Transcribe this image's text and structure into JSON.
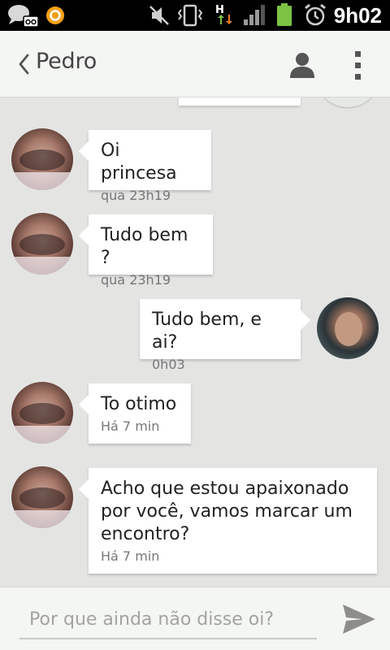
{
  "status_bar": {
    "time": "9h02",
    "icons": [
      "chat-notification-icon",
      "voicemail-icon",
      "app-notification-icon",
      "mute-icon",
      "vibrate-icon",
      "hspa-data-icon",
      "signal-icon",
      "battery-icon",
      "alarm-icon"
    ]
  },
  "header": {
    "contact_name": "Pedro",
    "icons": [
      "back-icon",
      "person-icon",
      "overflow-menu-icon"
    ]
  },
  "messages": [
    {
      "direction": "incoming",
      "text": "Oi princesa",
      "time": "qua  23h19"
    },
    {
      "direction": "incoming",
      "text": "Tudo bem ?",
      "time": "qua  23h19"
    },
    {
      "direction": "outgoing",
      "text": "Tudo bem, e ai?",
      "time": "0h03"
    },
    {
      "direction": "incoming",
      "text": "To otimo",
      "time": "Há 7 min"
    },
    {
      "direction": "incoming",
      "text": "Acho que estou apaixonado\npor você,  vamos marcar um\nencontro?",
      "time": "Há 7 min"
    }
  ],
  "compose": {
    "placeholder": "Por que ainda não disse oi?",
    "value": ""
  },
  "colors": {
    "status_bar": "#000000",
    "action_bar": "#f4f6f3",
    "thread_background": "#e4e5e3",
    "bubble": "#ffffff",
    "battery": "#7dc242",
    "send": "#8d8e8c"
  }
}
